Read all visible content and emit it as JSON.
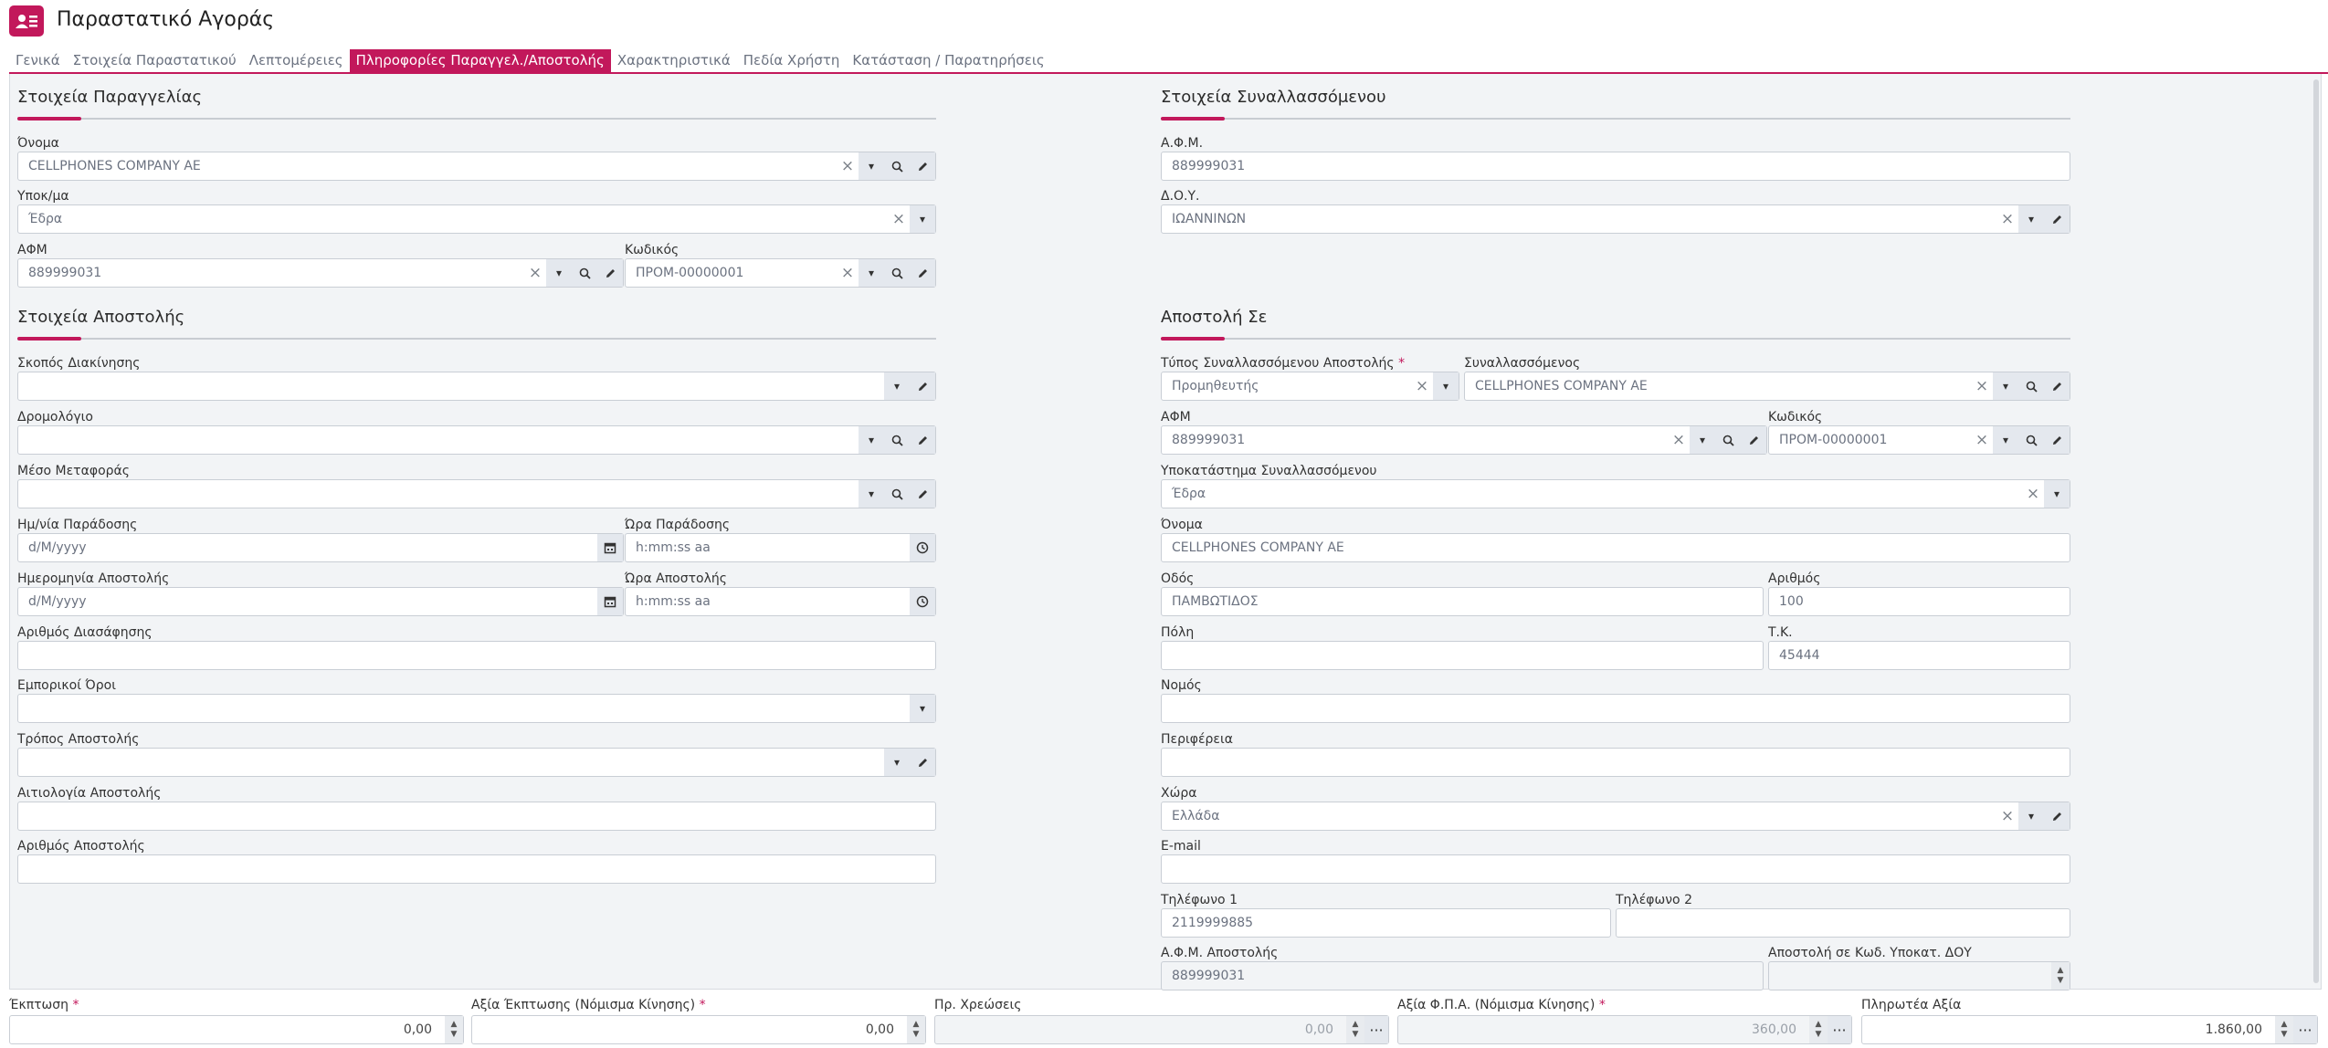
{
  "header": {
    "title": "Παραστατικό Αγοράς",
    "icon": "contact-card-icon"
  },
  "tabs": [
    {
      "label": "Γενικά"
    },
    {
      "label": "Στοιχεία Παραστατικού"
    },
    {
      "label": "Λεπτομέρειες"
    },
    {
      "label": "Πληροφορίες Παραγγελ./Αποστολής"
    },
    {
      "label": "Χαρακτηριστικά"
    },
    {
      "label": "Πεδία Χρήστη"
    },
    {
      "label": "Κατάσταση / Παρατηρήσεις"
    }
  ],
  "order_section": {
    "title": "Στοιχεία Παραγγελίας",
    "name_label": "Όνομα",
    "name_value": "CELLPHONES COMPANY AE",
    "branch_label": "Υποκ/μα",
    "branch_value": "Έδρα",
    "afm_label": "ΑΦΜ",
    "afm_value": "889999031",
    "code_label": "Κωδικός",
    "code_value": "ΠΡΟΜ-00000001"
  },
  "trader_section": {
    "title": "Στοιχεία Συναλλασσόμενου",
    "afm_label": "Α.Φ.Μ.",
    "afm_value": "889999031",
    "doy_label": "Δ.Ο.Υ.",
    "doy_value": "ΙΩΑΝΝΙΝΩΝ"
  },
  "shipping_section": {
    "title": "Στοιχεία Αποστολής",
    "purpose_label": "Σκοπός Διακίνησης",
    "route_label": "Δρομολόγιο",
    "transport_label": "Μέσο Μεταφοράς",
    "delivery_date_label": "Ημ/νία Παράδοσης",
    "delivery_date_placeholder": "d/M/yyyy",
    "delivery_time_label": "Ώρα Παράδοσης",
    "delivery_time_placeholder": "h:mm:ss aa",
    "ship_date_label": "Ημερομηνία Αποστολής",
    "ship_date_placeholder": "d/M/yyyy",
    "ship_time_label": "Ώρα Αποστολής",
    "ship_time_placeholder": "h:mm:ss aa",
    "clarification_label": "Αριθμός Διασάφησης",
    "terms_label": "Εμπορικοί Όροι",
    "method_label": "Τρόπος Αποστολής",
    "reason_label": "Αιτιολογία Αποστολής",
    "number_label": "Αριθμός Αποστολής"
  },
  "ship_to_section": {
    "title": "Αποστολή Σε",
    "type_label": "Τύπος Συναλλασσόμενου Αποστολής",
    "type_value": "Προμηθευτής",
    "trader_label": "Συναλλασσόμενος",
    "trader_value": "CELLPHONES COMPANY AE",
    "afm_label": "ΑΦΜ",
    "afm_value": "889999031",
    "code_label": "Κωδικός",
    "code_value": "ΠΡΟΜ-00000001",
    "branch_label": "Υποκατάστημα Συναλλασσόμενου",
    "branch_value": "Έδρα",
    "name_label": "Όνομα",
    "name_value": "CELLPHONES COMPANY AE",
    "street_label": "Οδός",
    "street_value": "ΠΑΜΒΩΤΙΔΟΣ",
    "number_label": "Αριθμός",
    "number_value": "100",
    "city_label": "Πόλη",
    "zip_label": "Τ.Κ.",
    "zip_value": "45444",
    "prefecture_label": "Νομός",
    "region_label": "Περιφέρεια",
    "country_label": "Χώρα",
    "country_value": "Ελλάδα",
    "email_label": "E-mail",
    "phone1_label": "Τηλέφωνο 1",
    "phone1_value": "2119999885",
    "phone2_label": "Τηλέφωνο 2",
    "ship_afm_label": "Α.Φ.Μ. Αποστολής",
    "ship_afm_value": "889999031",
    "doy_code_label": "Αποστολή σε Κωδ. Υποκατ. ΔΟΥ"
  },
  "totals": {
    "discount_label": "Έκπτωση",
    "discount_value": "0,00",
    "discount_amount_label": "Αξία Έκπτωσης (Νόμισμα Κίνησης)",
    "discount_amount_value": "0,00",
    "charges_label": "Πρ. Χρεώσεις",
    "charges_value": "0,00",
    "vat_label": "Αξία Φ.Π.Α. (Νόμισμα Κίνησης)",
    "vat_value": "360,00",
    "payable_label": "Πληρωτέα Αξία",
    "payable_value": "1.860,00"
  },
  "accent_color": "#c2185b"
}
